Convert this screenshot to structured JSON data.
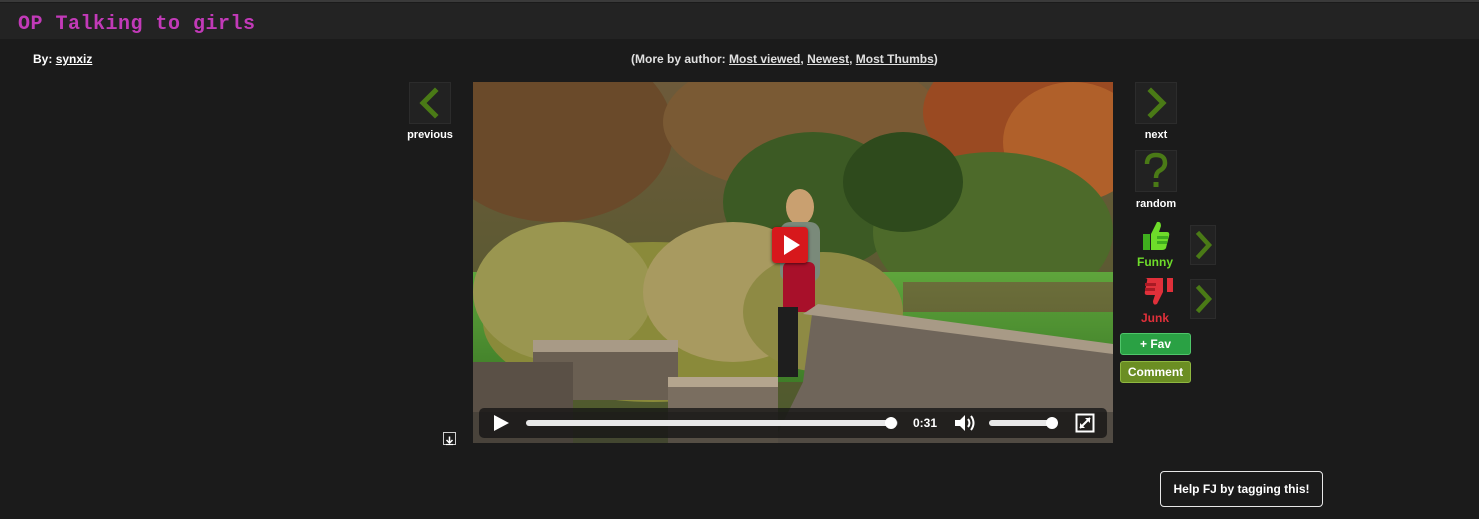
{
  "page": {
    "title": "OP Talking to girls"
  },
  "byline": {
    "prefix": "By:",
    "author": "synxiz"
  },
  "more_by": {
    "prefix": "(More by author:",
    "links": [
      "Most viewed",
      "Newest",
      "Most Thumbs"
    ],
    "separator": ",",
    "suffix": ")"
  },
  "nav": {
    "previous_label": "previous",
    "next_label": "next",
    "random_label": "random"
  },
  "video": {
    "time": "0:31",
    "progress_fraction": 0.98,
    "volume_fraction": 0.96
  },
  "votes": {
    "funny_label": "Funny",
    "junk_label": "Junk"
  },
  "actions": {
    "fav_label": "+ Fav",
    "comment_label": "Comment",
    "tag_label": "Help FJ by tagging this!"
  },
  "colors": {
    "title": "#c23ab8",
    "arrow_green": "#4a7a16",
    "funny_green": "#6edc2a",
    "junk_red": "#e0303a",
    "fav_green": "#2aa144",
    "comment_olive": "#6b8e23",
    "play_red": "#d7181c"
  },
  "icons": {
    "previous": "chevron-left-icon",
    "next": "chevron-right-icon",
    "random": "question-mark-icon",
    "funny": "thumbs-up-icon",
    "junk": "thumbs-down-icon",
    "play": "play-icon",
    "volume": "speaker-icon",
    "fullscreen": "fullscreen-icon",
    "download": "download-icon"
  }
}
